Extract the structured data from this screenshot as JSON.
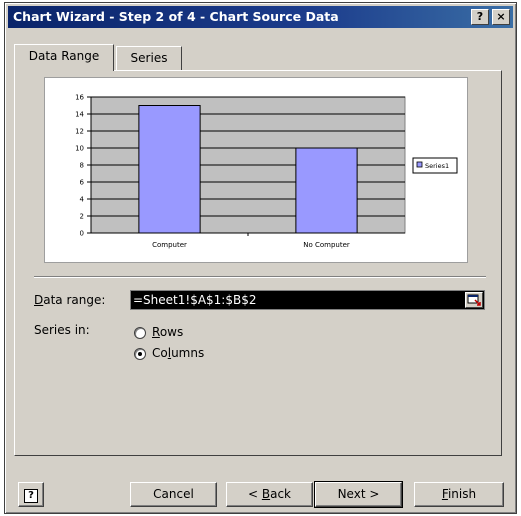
{
  "window": {
    "title": "Chart Wizard - Step 2 of 4 - Chart Source Data",
    "help_glyph": "?",
    "close_glyph": "×"
  },
  "tabs": [
    {
      "label": "Data Range",
      "active": true
    },
    {
      "label": "Series",
      "active": false
    }
  ],
  "chart_data": {
    "type": "bar",
    "categories": [
      "Computer",
      "No Computer"
    ],
    "series": [
      {
        "name": "Series1",
        "values": [
          15,
          10
        ]
      }
    ],
    "ylim": [
      0,
      16
    ],
    "y_ticks": [
      "0",
      "2",
      "4",
      "6",
      "8",
      "10",
      "12",
      "14",
      "16"
    ],
    "bar_color": "#9999ff",
    "plot_bg": "#c0c0c0",
    "grid": true,
    "legend_position": "right"
  },
  "form": {
    "data_range_label_prefix": "D",
    "data_range_label_rest": "ata range:",
    "data_range_value": "=Sheet1!$A$1:$B$2",
    "series_in_label": "Series in:",
    "options": [
      {
        "ul": "R",
        "rest": "ows",
        "selected": false
      },
      {
        "pre": "Co",
        "ul": "l",
        "rest": "umns",
        "selected": true
      }
    ]
  },
  "buttons": {
    "help_glyph": "?",
    "cancel": "Cancel",
    "back_pre": "< ",
    "back_ul": "B",
    "back_rest": "ack",
    "next": "Next >",
    "finish_ul": "F",
    "finish_rest": "inish"
  },
  "colors": {
    "title_bar": "#0a246a",
    "dialog_bg": "#d4d0c8",
    "selection": "#000000"
  }
}
